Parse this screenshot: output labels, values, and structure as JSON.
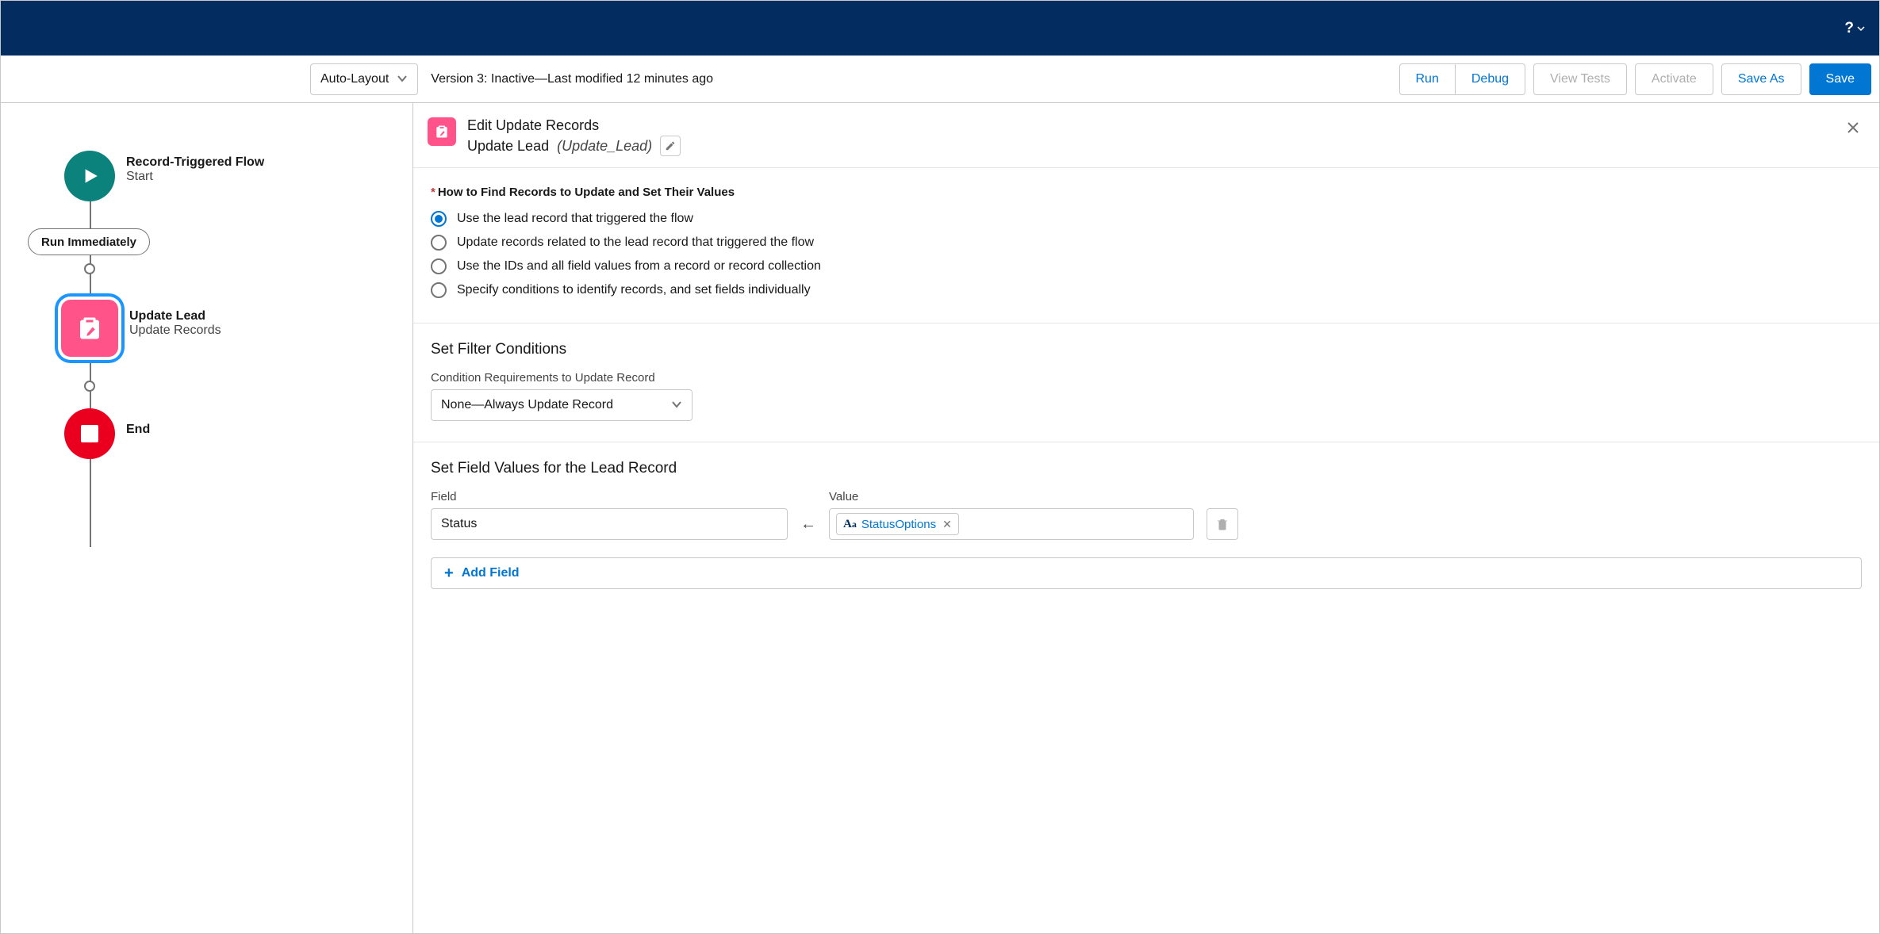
{
  "topbar": {
    "help": "?"
  },
  "toolbar": {
    "layout_mode": "Auto-Layout",
    "version_text": "Version 3: Inactive—Last modified 12 minutes ago",
    "run": "Run",
    "debug": "Debug",
    "view_tests": "View Tests",
    "activate": "Activate",
    "save_as": "Save As",
    "save": "Save"
  },
  "canvas": {
    "start": {
      "title": "Record-Triggered Flow",
      "sub": "Start"
    },
    "run_immediately": "Run Immediately",
    "update": {
      "title": "Update Lead",
      "sub": "Update Records"
    },
    "end": {
      "title": "End"
    }
  },
  "panel": {
    "header": {
      "line1": "Edit Update Records",
      "element_label": "Update Lead",
      "api_name": "(Update_Lead)"
    },
    "find_section": {
      "label": "How to Find Records to Update and Set Their Values",
      "options": [
        "Use the lead record that triggered the flow",
        "Update records related to the lead record that triggered the flow",
        "Use the IDs and all field values from a record or record collection",
        "Specify conditions to identify records, and set fields individually"
      ],
      "selected_index": 0
    },
    "filter_section": {
      "heading": "Set Filter Conditions",
      "sub_label": "Condition Requirements to Update Record",
      "select_value": "None—Always Update Record"
    },
    "values_section": {
      "heading": "Set Field Values for the Lead Record",
      "field_label": "Field",
      "value_label": "Value",
      "rows": [
        {
          "field": "Status",
          "value_token": "StatusOptions"
        }
      ],
      "add_field": "Add Field"
    }
  }
}
